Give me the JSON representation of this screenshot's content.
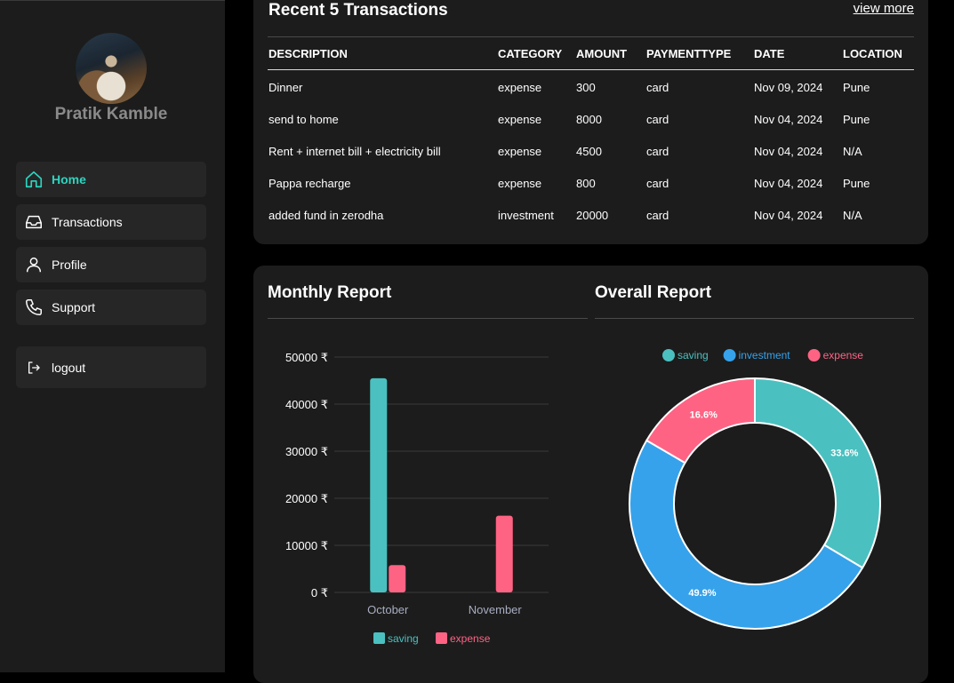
{
  "sidebar": {
    "profile_name": "Pratik Kamble",
    "items": [
      {
        "label": "Home",
        "icon": "home-icon",
        "active": true
      },
      {
        "label": "Transactions",
        "icon": "inbox-icon"
      },
      {
        "label": "Profile",
        "icon": "user-icon"
      },
      {
        "label": "Support",
        "icon": "phone-icon"
      }
    ],
    "logout_label": "logout",
    "accent_color": "#2dd4bf"
  },
  "transactions": {
    "title": "Recent 5 Transactions",
    "view_more": "view more",
    "columns": [
      "DESCRIPTION",
      "CATEGORY",
      "AMOUNT",
      "PAYMENTTYPE",
      "DATE",
      "LOCATION"
    ],
    "rows": [
      [
        "Dinner",
        "expense",
        "300",
        "card",
        "Nov 09, 2024",
        "Pune"
      ],
      [
        "send to home",
        "expense",
        "8000",
        "card",
        "Nov 04, 2024",
        "Pune"
      ],
      [
        "Rent + internet bill + electricity bill",
        "expense",
        "4500",
        "card",
        "Nov 04, 2024",
        "N/A"
      ],
      [
        "Pappa recharge",
        "expense",
        "800",
        "card",
        "Nov 04, 2024",
        "Pune"
      ],
      [
        "added fund in zerodha",
        "investment",
        "20000",
        "card",
        "Nov 04, 2024",
        "N/A"
      ]
    ]
  },
  "reports": {
    "monthly_title": "Monthly Report",
    "overall_title": "Overall Report"
  },
  "chart_data": [
    {
      "type": "bar",
      "categories": [
        "October",
        "November"
      ],
      "series": [
        {
          "name": "saving",
          "values": [
            45500,
            0
          ],
          "color": "#4bc0c0"
        },
        {
          "name": "expense",
          "values": [
            5800,
            16300
          ],
          "color": "#ff6384"
        }
      ],
      "ylim": [
        0,
        50000
      ],
      "yticks": [
        0,
        10000,
        20000,
        30000,
        40000,
        50000
      ],
      "ytick_labels": [
        "0 ₹",
        "10000 ₹",
        "20000 ₹",
        "30000 ₹",
        "40000 ₹",
        "50000 ₹"
      ],
      "grid": true,
      "legend": "bottom"
    },
    {
      "type": "pie",
      "donut": true,
      "categories": [
        "saving",
        "investment",
        "expense"
      ],
      "values": [
        33.6,
        49.9,
        16.6
      ],
      "labels": [
        "33.6%",
        "49.9%",
        "16.6%"
      ],
      "colors": [
        "#4bc0c0",
        "#36a2eb",
        "#ff6384"
      ],
      "legend": "top"
    }
  ]
}
